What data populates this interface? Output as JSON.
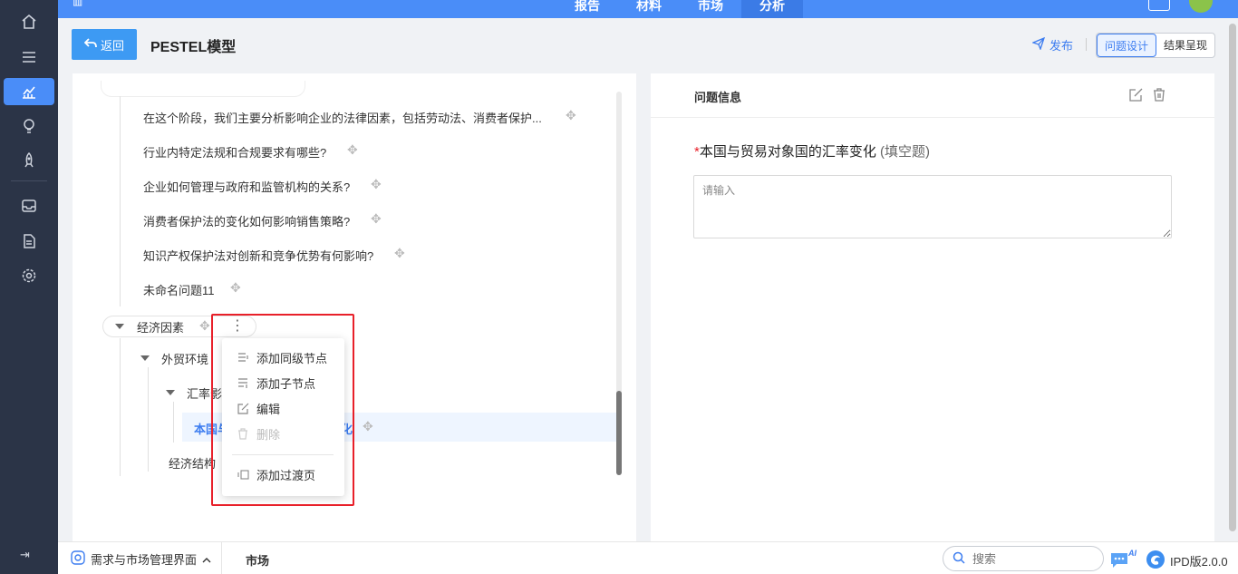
{
  "header": {
    "tabs": [
      "报告",
      "材料",
      "市场",
      "分析"
    ],
    "active_tab_index": 3
  },
  "page": {
    "back_label": "返回",
    "title": "PESTEL模型",
    "publish_label": "发布",
    "view_modes": [
      "问题设计",
      "结果呈现"
    ],
    "active_view_mode": "问题设计"
  },
  "tree": {
    "questions": [
      "在这个阶段，我们主要分析影响企业的法律因素，包括劳动法、消费者保护...",
      "行业内特定法规和合规要求有哪些?",
      "企业如何管理与政府和监管机构的关系?",
      "消费者保护法的变化如何影响销售策略?",
      "知识产权保护法对创新和竞争优势有何影响?",
      "未命名问题11"
    ],
    "category": "经济因素",
    "sub_node": "外贸环境",
    "sub_sub_node": "汇率影",
    "selected_item": "本国与",
    "selected_item_tail": "化",
    "sibling_node": "经济结构"
  },
  "context_menu": {
    "items": [
      "添加同级节点",
      "添加子节点",
      "编辑",
      "删除"
    ],
    "extra_item": "添加过渡页",
    "disabled_item": "删除"
  },
  "question_info": {
    "panel_title": "问题信息",
    "required_mark": "*",
    "question_title": "本国与贸易对象国的汇率变化",
    "question_type": "(填空题)",
    "answer_placeholder": "请输入"
  },
  "bottom": {
    "workspace_label": "需求与市场管理界面",
    "current_tab": "市场",
    "search_placeholder": "搜索",
    "ai_badge": "AI",
    "version": "IPD版2.0.0"
  },
  "colors": {
    "primary": "#4a8df8",
    "nav_bg": "#2b3447",
    "highlight": "#e8202a",
    "link": "#3d7df0"
  }
}
